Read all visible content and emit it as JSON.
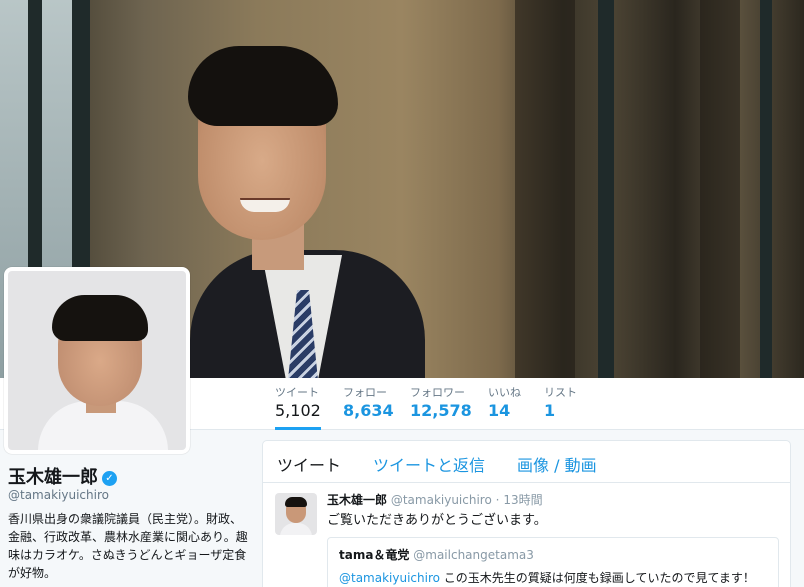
{
  "profile": {
    "name": "玉木雄一郎",
    "handle": "@tamakiyuichiro",
    "bio": "香川県出身の衆議院議員（民主党）。財政、金融、行政改革、農林水産業に関心あり。趣味はカラオケ。さぬきうどんとギョーザ定食が好物。",
    "verified_icon": "✓"
  },
  "stats": [
    {
      "label": "ツイート",
      "value": "5,102"
    },
    {
      "label": "フォロー",
      "value": "8,634"
    },
    {
      "label": "フォロワー",
      "value": "12,578"
    },
    {
      "label": "いいね",
      "value": "14"
    },
    {
      "label": "リスト",
      "value": "1"
    }
  ],
  "tabs": [
    {
      "label": "ツイート"
    },
    {
      "label": "ツイートと返信"
    },
    {
      "label": "画像 / 動画"
    }
  ],
  "tweet": {
    "name": "玉木雄一郎",
    "handle": "@tamakiyuichiro",
    "dot": "·",
    "time": "13時間",
    "text": "ご覧いただきありがとうございます。",
    "quote": {
      "name": "tama＆竜党",
      "handle": "@mailchangetama3",
      "mention": "@tamakiyuichiro",
      "text": " この玉木先生の質疑は何度も録画していたので見てます！"
    }
  },
  "colors": {
    "accent": "#1da1f2",
    "link": "#1b95e0",
    "muted": "#657786"
  }
}
